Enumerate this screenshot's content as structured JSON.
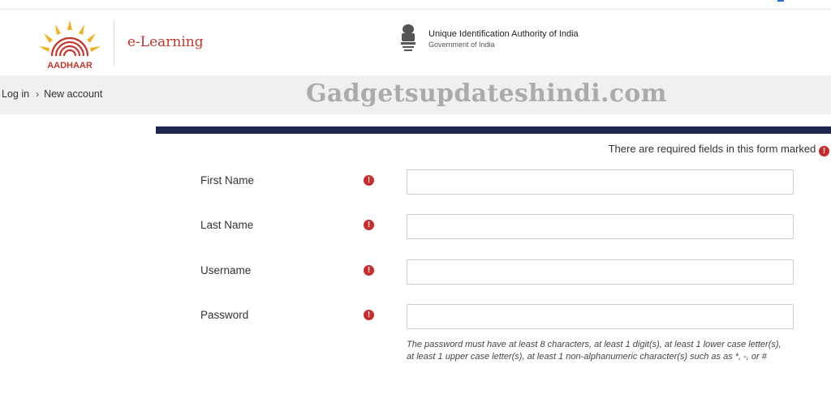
{
  "header": {
    "logo_text": "AADHAAR",
    "app_name": "e-Learning",
    "org_name": "Unique Identification Authority of India",
    "org_sub": "Government of India"
  },
  "breadcrumb": {
    "items": [
      "Log in",
      "New account"
    ],
    "separator": "›"
  },
  "watermark": "Gadgetsupdateshindi.com",
  "form": {
    "required_note": "There are required fields in this form marked",
    "required_icon": "!",
    "fields": [
      {
        "label": "First Name",
        "value": "",
        "placeholder": ""
      },
      {
        "label": "Last Name",
        "value": "",
        "placeholder": ""
      },
      {
        "label": "Username",
        "value": "",
        "placeholder": ""
      },
      {
        "label": "Password",
        "value": "",
        "placeholder": ""
      }
    ],
    "password_hint": "The password must have at least 8 characters, at least 1 digit(s), at least 1 lower case letter(s), at least 1 upper case letter(s), at least 1 non-alphanumeric character(s) such as as *, -, or #"
  },
  "colors": {
    "brand_red": "#c4372c",
    "form_band": "#1d2550",
    "required_red": "#c92c2c",
    "crumb_bg": "#f0f0f0"
  }
}
